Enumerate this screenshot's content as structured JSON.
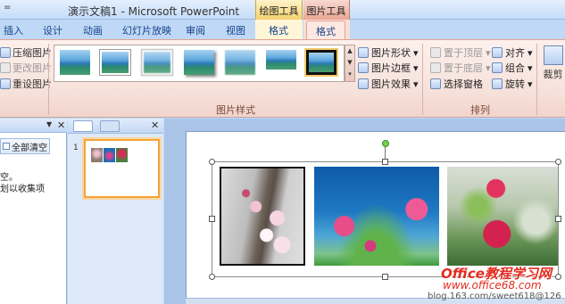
{
  "title_bar": {
    "title": "演示文稿1 - Microsoft PowerPoint",
    "quick_access": "=",
    "context_groups": [
      "绘图工具",
      "图片工具"
    ]
  },
  "tabs": [
    {
      "label": "插入"
    },
    {
      "label": "设计"
    },
    {
      "label": "动画"
    },
    {
      "label": "幻灯片放映"
    },
    {
      "label": "审阅"
    },
    {
      "label": "视图"
    },
    {
      "label": "格式"
    },
    {
      "label": "格式",
      "active": true
    }
  ],
  "ribbon": {
    "adjust_cmds": [
      "压缩图片",
      "更改图片",
      "重设图片"
    ],
    "styles_group_label": "图片样式",
    "style_thumbnails": [
      "plain",
      "white-frame",
      "soft-shadow",
      "shadow",
      "soft-edge",
      "reflection",
      "black-frame"
    ],
    "style_cmds": [
      "图片形状",
      "图片边框",
      "图片效果"
    ],
    "arrange_cmds": [
      "置于顶层",
      "置于底层",
      "选择窗格"
    ],
    "align_cmds": [
      "对齐",
      "组合",
      "旋转"
    ],
    "arrange_group_label": "排列",
    "crop_partial": "裁剪"
  },
  "task_pane": {
    "clear_button": "全部清空",
    "hint_lines": [
      "空。",
      "划以收集项"
    ]
  },
  "slides_pane": {
    "slide_number": "1"
  },
  "watermark": {
    "main": "Office教程学习网",
    "url": "www.office68.com",
    "blog": "blog.163.com/sweet618@126"
  },
  "colors": {
    "picture_tools_tab": "#f9ddd6",
    "drawing_tools_tab": "#fff6d8",
    "ribbon_bg": "#f6e1da",
    "selection_thumb_border": "#f3a33b",
    "watermark_red": "#e32b1e"
  }
}
